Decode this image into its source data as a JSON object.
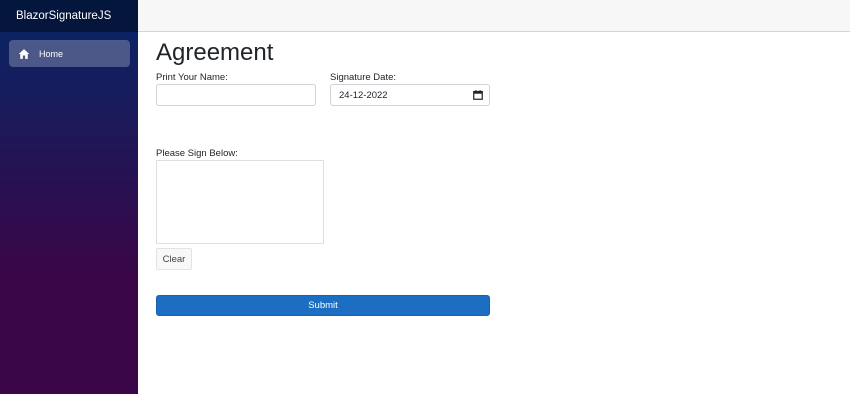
{
  "sidebar": {
    "brand": "BlazorSignatureJS",
    "items": [
      {
        "label": "Home",
        "icon": "home-icon"
      }
    ]
  },
  "form": {
    "title": "Agreement",
    "name_label": "Print Your Name:",
    "name_value": "",
    "date_label": "Signature Date:",
    "date_value": "24-12-2022",
    "signature_label": "Please Sign Below:",
    "clear_label": "Clear",
    "submit_label": "Submit"
  },
  "colors": {
    "sidebar_top": "#052767",
    "sidebar_bottom": "#3a0647",
    "primary_button": "#1b6ec2"
  }
}
